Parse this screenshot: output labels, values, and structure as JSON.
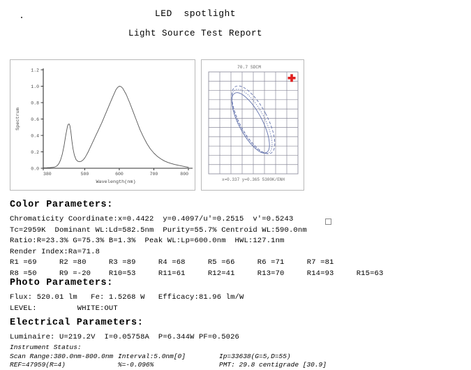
{
  "header": {
    "title": "LED  spotlight",
    "subtitle": "Light Source Test Report"
  },
  "chart_data": [
    {
      "type": "line",
      "name": "spectrum-chart",
      "title": "",
      "xlabel": "Wavelength(nm)",
      "ylabel": "Spectrum",
      "xlim": [
        380,
        800
      ],
      "ylim": [
        0.0,
        1.2
      ],
      "xticks": [
        380,
        500,
        600,
        700,
        800
      ],
      "yticks": [
        "0.0",
        "0.2",
        "0.4",
        "0.6",
        "0.8",
        "1.0",
        "1.2"
      ],
      "grid": false,
      "legend": "none",
      "line_color": "#555555",
      "x": [
        380,
        390,
        400,
        410,
        415,
        420,
        425,
        430,
        435,
        440,
        445,
        450,
        452,
        455,
        457,
        460,
        463,
        466,
        470,
        475,
        480,
        485,
        490,
        495,
        500,
        505,
        510,
        515,
        520,
        530,
        540,
        550,
        560,
        570,
        580,
        590,
        595,
        600,
        605,
        610,
        620,
        630,
        640,
        650,
        660,
        670,
        680,
        690,
        700,
        710,
        720,
        730,
        740,
        750,
        760,
        770,
        780,
        790,
        800
      ],
      "y": [
        0.005,
        0.006,
        0.008,
        0.012,
        0.018,
        0.03,
        0.055,
        0.1,
        0.17,
        0.27,
        0.4,
        0.51,
        0.535,
        0.54,
        0.52,
        0.44,
        0.33,
        0.24,
        0.16,
        0.105,
        0.085,
        0.08,
        0.085,
        0.1,
        0.125,
        0.16,
        0.2,
        0.245,
        0.29,
        0.38,
        0.47,
        0.56,
        0.66,
        0.76,
        0.86,
        0.955,
        0.985,
        1.0,
        0.995,
        0.975,
        0.9,
        0.8,
        0.69,
        0.58,
        0.47,
        0.38,
        0.3,
        0.235,
        0.185,
        0.145,
        0.115,
        0.09,
        0.072,
        0.058,
        0.046,
        0.037,
        0.028,
        0.02,
        0.012
      ]
    },
    {
      "type": "scatter",
      "name": "cie-chromaticity-chart",
      "title": "70.7 SDCM",
      "footer": "x=0.337 y=0.365 5300K/ENH",
      "grid": true,
      "grid_cols": 8,
      "grid_rows": 11,
      "grid_color": "#8a8a9a",
      "ellipse_color": "#5b6ba8",
      "marker": "red-cross",
      "marker_color": "#e02020",
      "marker_x": 0.93,
      "marker_y": 0.06,
      "ellipses": [
        {
          "style": "solid",
          "cx": 0.47,
          "cy": 0.5,
          "rx": 0.13,
          "ry": 0.33,
          "rotate": -28
        },
        {
          "style": "dashed",
          "cx": 0.5,
          "cy": 0.47,
          "rx": 0.155,
          "ry": 0.37,
          "rotate": -28
        },
        {
          "style": "dotted",
          "cx": 0.485,
          "cy": 0.485,
          "rx": 0.142,
          "ry": 0.35,
          "rotate": -28
        }
      ]
    }
  ],
  "color_parameters": {
    "heading": "Color Parameters:",
    "lines": [
      "Chromaticity Coordinate:x=0.4422  y=0.4097/u'=0.2515  v'=0.5243",
      "Tc=2959K  Dominant WL:Ld=582.5nm  Purity=55.7% Centroid WL:590.0nm",
      "Ratio:R=23.3% G=75.3% B=1.3%  Peak WL:Lp=600.0nm  HWL:127.1nm",
      "Render Index:Ra=71.8",
      "R1 =69     R2 =80     R3 =89     R4 =68     R5 =66     R6 =71     R7 =81",
      "R8 =50     R9 =-20    R10=53     R11=61     R12=41     R13=70     R14=93     R15=63"
    ]
  },
  "photo_parameters": {
    "heading": "Photo Parameters:",
    "lines": [
      "Flux: 520.01 lm   Fe: 1.5268 W   Efficacy:81.96 lm/W",
      "LEVEL:         WHITE:OUT"
    ]
  },
  "electrical_parameters": {
    "heading": "Electrical Parameters:",
    "lines": [
      "Luminaire: U=219.2V  I=0.05758A  P=6.344W PF=0.5026"
    ]
  },
  "instrument_status": {
    "heading": "Instrument Status:",
    "rows": [
      [
        "Scan Range:380.0nm-800.0nm",
        "Interval:5.0nm[0]",
        "Ip=33638(G=5,D=55)"
      ],
      [
        "REF=47959(R=4)",
        "%=-0.096%",
        "PMT: 29.8 centigrade [30.9]"
      ]
    ]
  }
}
